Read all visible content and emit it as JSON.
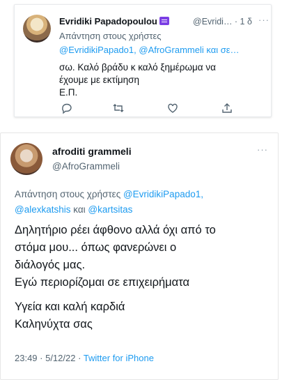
{
  "tweet1": {
    "display_name": "Evridiki Papadopoulou",
    "handle_time": "@Evridi… · 1 δ",
    "more": "···",
    "reply_label": "Απάντηση στους χρήστες",
    "reply_mentions": "@EvridikiPapado1, @AfroGrammeli και σε…",
    "text_lines": [
      "σω. Καλό βράδυ κ καλό ξημέρωμα να",
      "έχουμε με εκτίμηση",
      "Ε.Π."
    ],
    "icons": [
      "reply-icon",
      "retweet-icon",
      "like-icon",
      "share-icon"
    ]
  },
  "tweet2": {
    "display_name": "afroditi grammeli",
    "handle": "@AfroGrammeli",
    "more": "···",
    "reply_prefix": "Απάντηση στους χρήστες",
    "reply_line1_mention": "@EvridikiPapado1,",
    "reply_line2_mention1": "@alexkatshis",
    "reply_line2_and": "και",
    "reply_line2_mention2": "@kartsitas",
    "text_lines": [
      "Δηλητήριο ρέει άφθονο αλλά όχι από το",
      "στόμα μου... όπως φανερώνει ο",
      "διάλογός μας.",
      "Εγώ περιορίζομαι σε επιχειρήματα",
      "Υγεία και καλή καρδιά",
      "Καληνύχτα σας"
    ],
    "timestamp": "23:49 · 5/12/22 ·",
    "source": "Twitter for iPhone"
  }
}
